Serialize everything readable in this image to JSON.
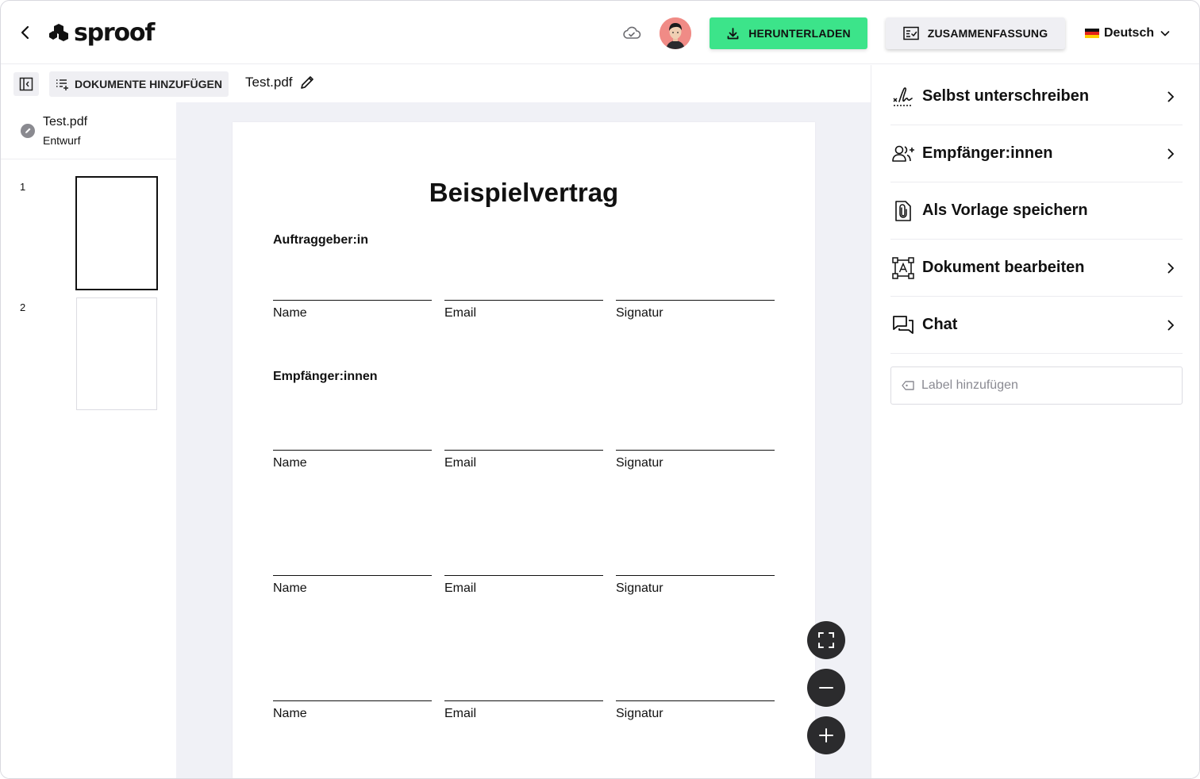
{
  "header": {
    "logo_text": "sproof",
    "download_label": "HERUNTERLADEN",
    "summary_label": "ZUSAMMENFASSUNG",
    "language": "Deutsch",
    "accent_color": "#3ce48a"
  },
  "toolbar": {
    "add_documents_label": "DOKUMENTE HINZUFÜGEN",
    "document_name": "Test.pdf"
  },
  "sidebar": {
    "file": {
      "name": "Test.pdf",
      "status": "Entwurf"
    },
    "pages": [
      {
        "number": "1",
        "selected": true
      },
      {
        "number": "2",
        "selected": false
      }
    ]
  },
  "document": {
    "title": "Beispielvertrag",
    "section_client": "Auftraggeber:in",
    "section_recipients": "Empfänger:innen",
    "field_labels": {
      "name": "Name",
      "email": "Email",
      "signature": "Signatur"
    }
  },
  "right_panel": {
    "actions": [
      {
        "label": "Selbst unterschreiben",
        "icon": "self-sign-icon",
        "has_chevron": true
      },
      {
        "label": "Empfänger:innen",
        "icon": "add-recipients-icon",
        "has_chevron": true
      },
      {
        "label": "Als Vorlage speichern",
        "icon": "save-template-icon",
        "has_chevron": false
      },
      {
        "label": "Dokument bearbeiten",
        "icon": "edit-document-icon",
        "has_chevron": true
      },
      {
        "label": "Chat",
        "icon": "chat-icon",
        "has_chevron": true
      }
    ],
    "label_placeholder": "Label hinzufügen"
  }
}
